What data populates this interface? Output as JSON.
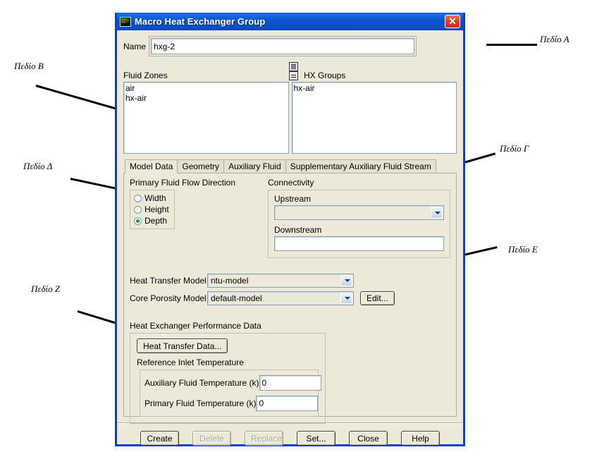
{
  "window": {
    "title": "Macro Heat Exchanger Group",
    "icon": "app-monitor-icon",
    "close_label": "✕"
  },
  "name_field": {
    "label": "Name",
    "value": "hxg-2",
    "placeholder": ""
  },
  "fluid_zones": {
    "label": "Fluid Zones",
    "items": [
      "air",
      "hx-air"
    ]
  },
  "hx_groups": {
    "label": "HX Groups",
    "items": [
      "hx-air"
    ]
  },
  "list_buttons": [
    {
      "name": "list-full-icon"
    },
    {
      "name": "list-compact-icon"
    }
  ],
  "tabs": [
    {
      "label": "Model Data",
      "active": true
    },
    {
      "label": "Geometry",
      "active": false
    },
    {
      "label": "Auxiliary Fluid",
      "active": false
    },
    {
      "label": "Supplementary Auxiliary Fluid Stream",
      "active": false
    }
  ],
  "flow_direction": {
    "label": "Primary Fluid Flow Direction",
    "options": [
      {
        "label": "Width",
        "selected": false
      },
      {
        "label": "Height",
        "selected": false
      },
      {
        "label": "Depth",
        "selected": true
      }
    ]
  },
  "connectivity": {
    "label": "Connectivity",
    "upstream": {
      "label": "Upstream",
      "value": ""
    },
    "downstream": {
      "label": "Downstream",
      "value": ""
    }
  },
  "models": {
    "heat_transfer": {
      "label": "Heat Transfer Model",
      "value": "ntu-model"
    },
    "core_porosity": {
      "label": "Core Porosity Model",
      "value": "default-model"
    },
    "edit_label": "Edit..."
  },
  "performance": {
    "label": "Heat Exchanger Performance Data",
    "heat_transfer_data_label": "Heat Transfer Data...",
    "reference_label": "Reference Inlet Temperature",
    "fields": [
      {
        "label": "Auxiliary Fluid Temperature (k)",
        "value": "0"
      },
      {
        "label": "Primary Fluid Temperature (k)",
        "value": "0"
      }
    ]
  },
  "footer_buttons": [
    {
      "label": "Create",
      "enabled": true
    },
    {
      "label": "Delete",
      "enabled": false
    },
    {
      "label": "Replace",
      "enabled": false
    },
    {
      "label": "Set...",
      "enabled": true
    },
    {
      "label": "Close",
      "enabled": true
    },
    {
      "label": "Help",
      "enabled": true
    }
  ],
  "annotations": [
    {
      "text": "Πεδίο Α"
    },
    {
      "text": "Πεδίο Β"
    },
    {
      "text": "Πεδίο Γ"
    },
    {
      "text": "Πεδίο Δ"
    },
    {
      "text": "Πεδίο Ε"
    },
    {
      "text": "Πεδίο Ζ"
    }
  ],
  "colors": {
    "dialog_bg": "#ece9d8",
    "titlebar_blue": "#0b4cc4",
    "border_blue": "#0a3fd4",
    "radio_selected": "#18a018",
    "close_red": "#e04020"
  }
}
